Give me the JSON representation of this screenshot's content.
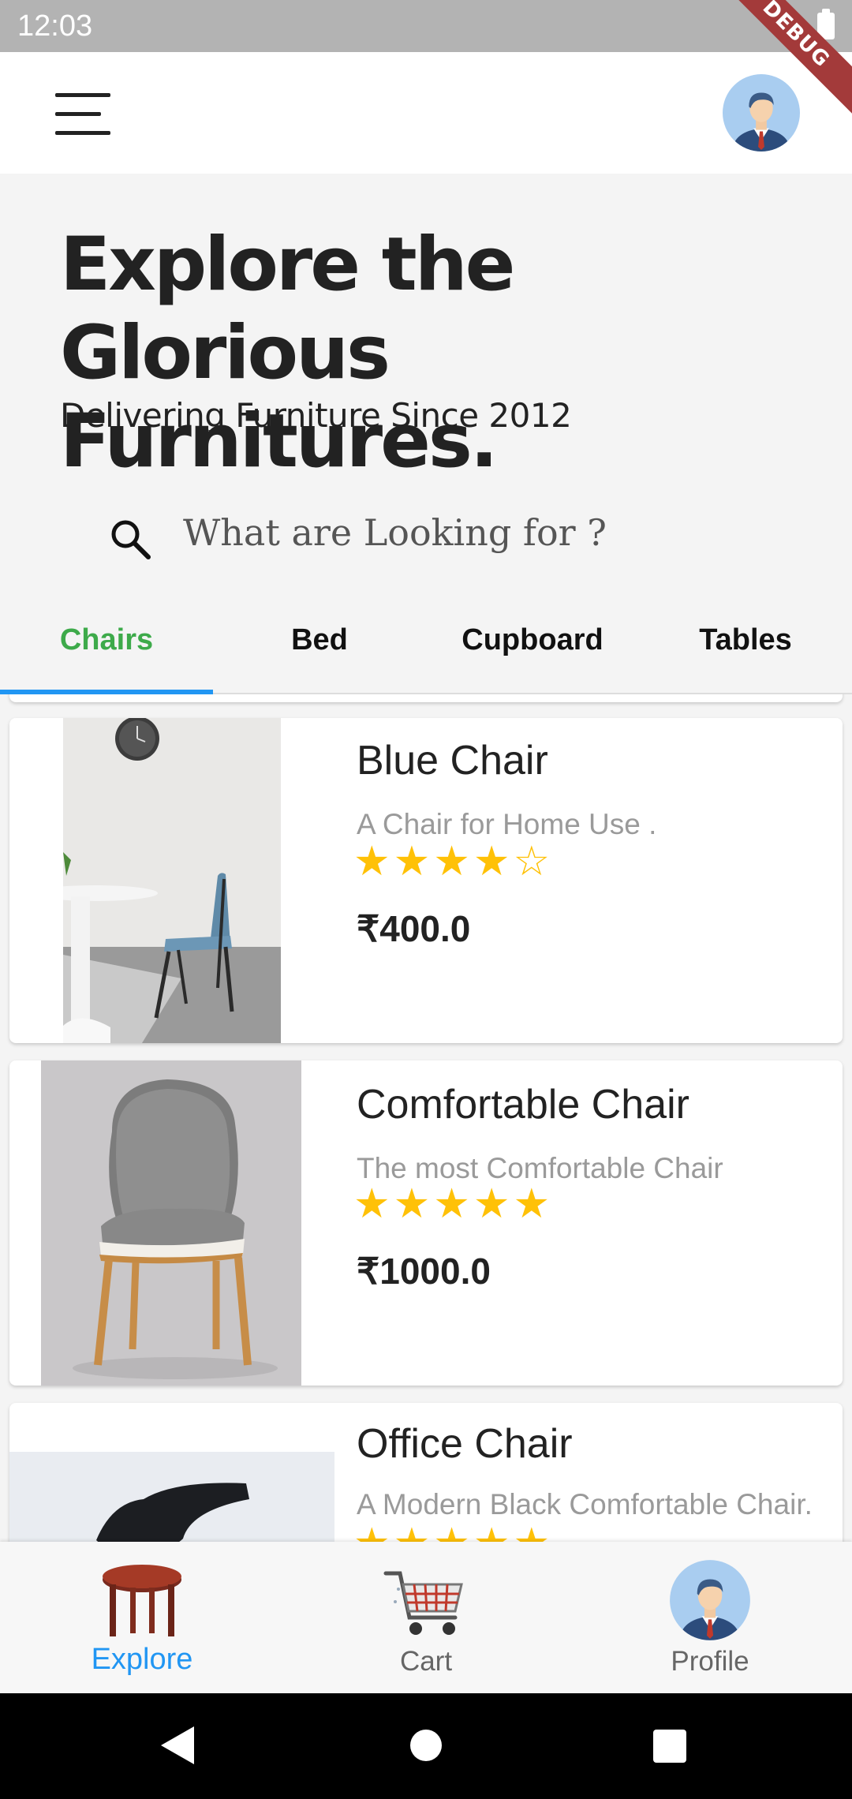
{
  "status_bar": {
    "time": "12:03",
    "debug_label": "DEBUG"
  },
  "header": {
    "title": "Explore the Glorious Furnitures.",
    "subtitle": "Delivering Furniture Since 2012"
  },
  "search": {
    "placeholder": "What are Looking for ?"
  },
  "tabs": [
    {
      "label": "Chairs",
      "active": true
    },
    {
      "label": "Bed",
      "active": false
    },
    {
      "label": "Cupboard",
      "active": false
    },
    {
      "label": "Tables",
      "active": false
    }
  ],
  "products": [
    {
      "name": "Blue Chair",
      "description": "A Chair for Home Use .",
      "stars": "★★★★☆",
      "rating": 4,
      "price": "₹400.0"
    },
    {
      "name": "Comfortable Chair",
      "description": "The most Comfortable Chair",
      "stars": "★★★★★",
      "rating": 5,
      "price": "₹1000.0"
    },
    {
      "name": "Office Chair",
      "description": "A Modern Black Comfortable Chair.",
      "stars": "★★★★★",
      "rating": 5,
      "price": ""
    }
  ],
  "bottom_nav": [
    {
      "label": "Explore",
      "icon": "table-icon",
      "active": true
    },
    {
      "label": "Cart",
      "icon": "cart-icon",
      "active": false
    },
    {
      "label": "Profile",
      "icon": "profile-avatar-icon",
      "active": false
    }
  ],
  "colors": {
    "active_tab": "#3daa4a",
    "accent": "#2196f3",
    "star": "#ffc107"
  }
}
